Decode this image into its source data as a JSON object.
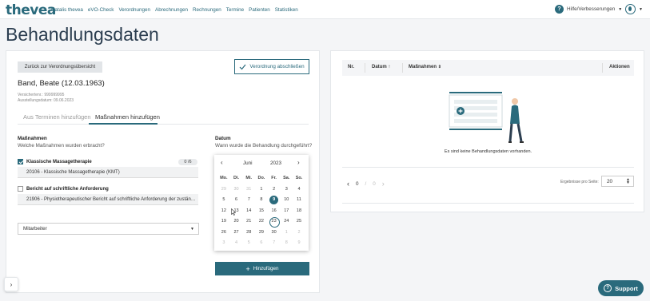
{
  "brand": {
    "logo": "thevea",
    "primary": "#2a6a7c"
  },
  "nav": [
    "Natalis thevea",
    "eVO-Check",
    "Verordnungen",
    "Abrechnungen",
    "Rechnungen",
    "Termine",
    "Patienten",
    "Statistiken"
  ],
  "header": {
    "help_label": "Hilfe/Verbesserungen",
    "help_icon": "?"
  },
  "page": {
    "title": "Behandlungsdaten"
  },
  "left": {
    "back_button": "Zurück zur Verordnungsübersicht",
    "close_button": "Verordnung abschließen",
    "patient_name": "Band, Beate (12.03.1963)",
    "insurance_no": "Versichertenr.: 999999995",
    "issue_date": "Ausstellungsdatum: 09.06.2023",
    "tabs": [
      "Aus Terminen hinzufügen",
      "Maßnahmen hinzufügen"
    ],
    "measures_title": "Maßnahmen",
    "measures_sub": "Welche Maßnahmen wurden erbracht?",
    "measure1": {
      "label": "Klassische Massagetherapie",
      "count": "0 /6",
      "detail": "20106 - Klassische Massagetherapie (KMT)",
      "checked": true
    },
    "measure2": {
      "label": "Bericht auf schriftliche Anforderung",
      "detail": "21906 - Physiotherapeutischer Bericht auf schriftliche Anforderung der zustän…",
      "checked": false
    },
    "employee_select": "Mitarbeiter",
    "date_title": "Datum",
    "date_sub": "Wann wurde die Behandlung durchgeführt?",
    "add_button": "Hinzufügen"
  },
  "calendar": {
    "month": "Juni",
    "year": "2023",
    "weekdays": [
      "Mo.",
      "Di.",
      "Mi.",
      "Do.",
      "Fr.",
      "Sa.",
      "So."
    ],
    "weeks": [
      [
        "29",
        "30",
        "31",
        "1",
        "2",
        "3",
        "4"
      ],
      [
        "5",
        "6",
        "7",
        "8",
        "9",
        "10",
        "11"
      ],
      [
        "12",
        "13",
        "14",
        "15",
        "16",
        "17",
        "18"
      ],
      [
        "19",
        "20",
        "21",
        "22",
        "23",
        "24",
        "25"
      ],
      [
        "26",
        "27",
        "28",
        "29",
        "30",
        "1",
        "2"
      ],
      [
        "3",
        "4",
        "5",
        "6",
        "7",
        "8",
        "9"
      ]
    ],
    "selected_day": "9",
    "today_day": "23"
  },
  "right": {
    "columns": [
      "Nr.",
      "Datum",
      "Maßnahmen",
      "Aktionen"
    ],
    "empty_text": "Es sind keine Behandlungsdaten vorhanden.",
    "page_current": "0",
    "page_sep": "/",
    "page_total": "0",
    "per_page_label": "Ergebnisse pro Seite:",
    "per_page_value": "20"
  },
  "support_label": "Support"
}
